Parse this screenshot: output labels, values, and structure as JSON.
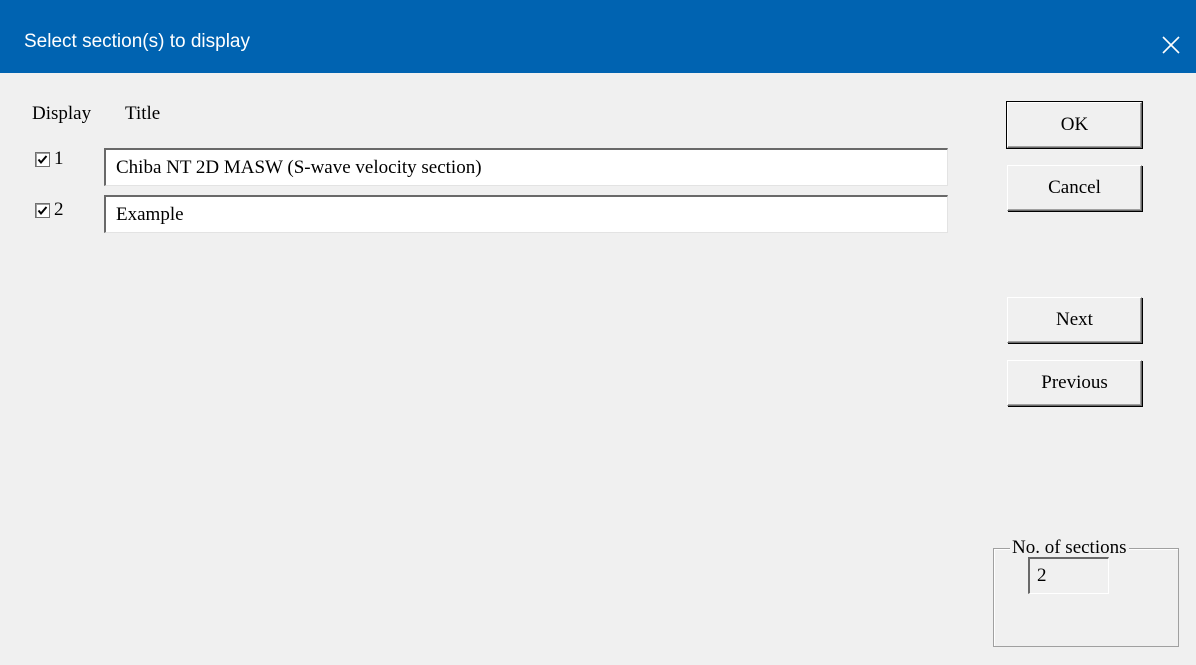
{
  "window": {
    "title": "Select section(s) to display",
    "close_icon": "close-icon"
  },
  "headers": {
    "display": "Display",
    "title": "Title"
  },
  "sections": [
    {
      "number": "1",
      "checked": true,
      "title": "Chiba NT 2D MASW (S-wave velocity section)"
    },
    {
      "number": "2",
      "checked": true,
      "title": "Example"
    }
  ],
  "buttons": {
    "ok": "OK",
    "cancel": "Cancel",
    "next": "Next",
    "previous": "Previous"
  },
  "section_count": {
    "label": "No. of sections",
    "value": "2"
  },
  "colors": {
    "titlebar": "#0063b1",
    "dialog_bg": "#f0f0f0"
  }
}
